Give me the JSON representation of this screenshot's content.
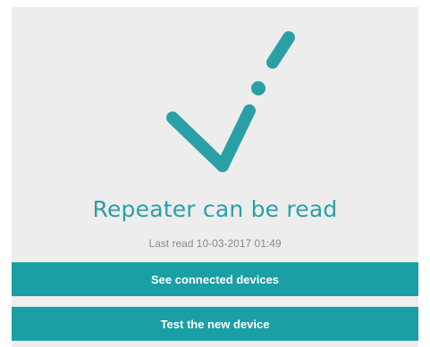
{
  "status": {
    "title": "Repeater can be read",
    "last_read": "Last read 10-03-2017 01:49",
    "icon": "checkmark-icon",
    "accent_color": "#2aa0a6"
  },
  "actions": {
    "see_connected_label": "See connected devices",
    "test_device_label": "Test the new device",
    "button_color": "#1a9fa4"
  }
}
